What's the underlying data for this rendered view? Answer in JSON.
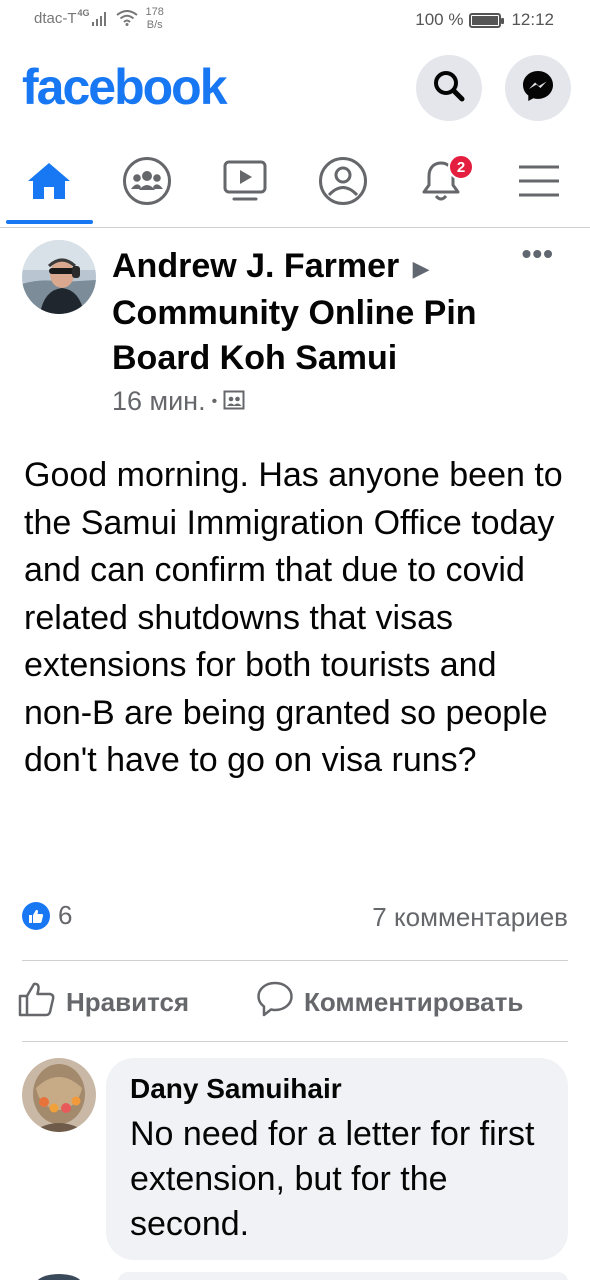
{
  "status_bar": {
    "carrier": "dtac-T",
    "network": "4G",
    "net_speed_value": "178",
    "net_speed_unit": "B/s",
    "battery": "100 %",
    "battery_level": 1.0,
    "time": "12:12"
  },
  "header": {
    "brand": "facebook",
    "search_icon": "search-icon",
    "messenger_icon": "messenger-icon"
  },
  "nav": {
    "items": [
      {
        "icon": "home-icon",
        "active": true
      },
      {
        "icon": "groups-icon"
      },
      {
        "icon": "watch-icon"
      },
      {
        "icon": "profile-icon"
      },
      {
        "icon": "notifications-icon",
        "badge": "2"
      },
      {
        "icon": "menu-icon"
      }
    ]
  },
  "post": {
    "author": "Andrew J. Farmer",
    "group": "Community Online Pin Board Koh Samui",
    "time": "16 мин.",
    "audience_icon": "group-privacy-icon",
    "text": "Good morning. Has anyone been to the Samui Immigration Office today and can confirm that due to covid related shutdowns that visas extensions for both tourists and non-B are being granted so people don't have to go on visa runs?",
    "reaction_count": "6",
    "comments_count": "7 комментариев",
    "like_label": "Нравится",
    "comment_label": "Комментировать"
  },
  "comment": {
    "name": "Dany Samuihair",
    "text": "No need for a letter for first extension, but for the second."
  },
  "colors": {
    "brand": "#1877f2",
    "badge": "#e41e3f",
    "secondary_text": "#65676b",
    "bubble": "#f0f2f5"
  }
}
